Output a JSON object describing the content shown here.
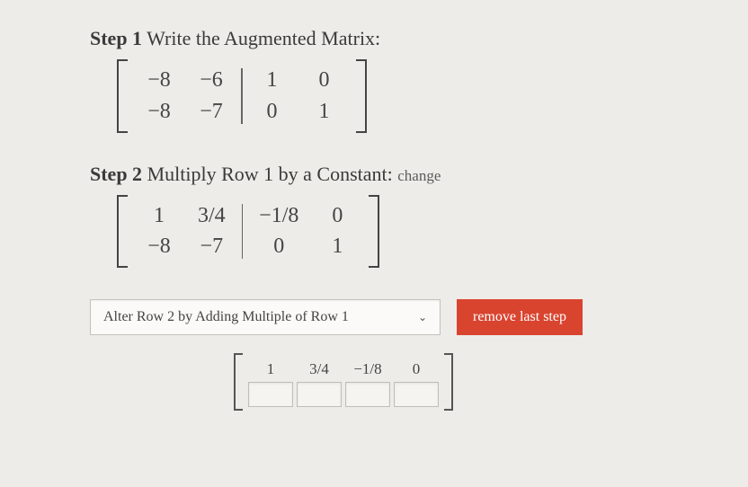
{
  "step1": {
    "label": "Step 1",
    "title": "Write the Augmented Matrix:",
    "matrix": {
      "left": [
        [
          "−8",
          "−6"
        ],
        [
          "−8",
          "−7"
        ]
      ],
      "right": [
        [
          "1",
          "0"
        ],
        [
          "0",
          "1"
        ]
      ]
    }
  },
  "step2": {
    "label": "Step 2",
    "title": "Multiply Row 1 by a Constant:",
    "change": "change",
    "matrix": {
      "left": [
        [
          "1",
          "3/4"
        ],
        [
          "−8",
          "−7"
        ]
      ],
      "right": [
        [
          "−1/8",
          "0"
        ],
        [
          "0",
          "1"
        ]
      ]
    }
  },
  "controls": {
    "dropdown_value": "Alter Row 2 by Adding Multiple of Row 1",
    "remove_label": "remove last step"
  },
  "input_matrix": {
    "row1": [
      "1",
      "3/4",
      "−1/8",
      "0"
    ],
    "row2": [
      "",
      "",
      "",
      ""
    ]
  }
}
